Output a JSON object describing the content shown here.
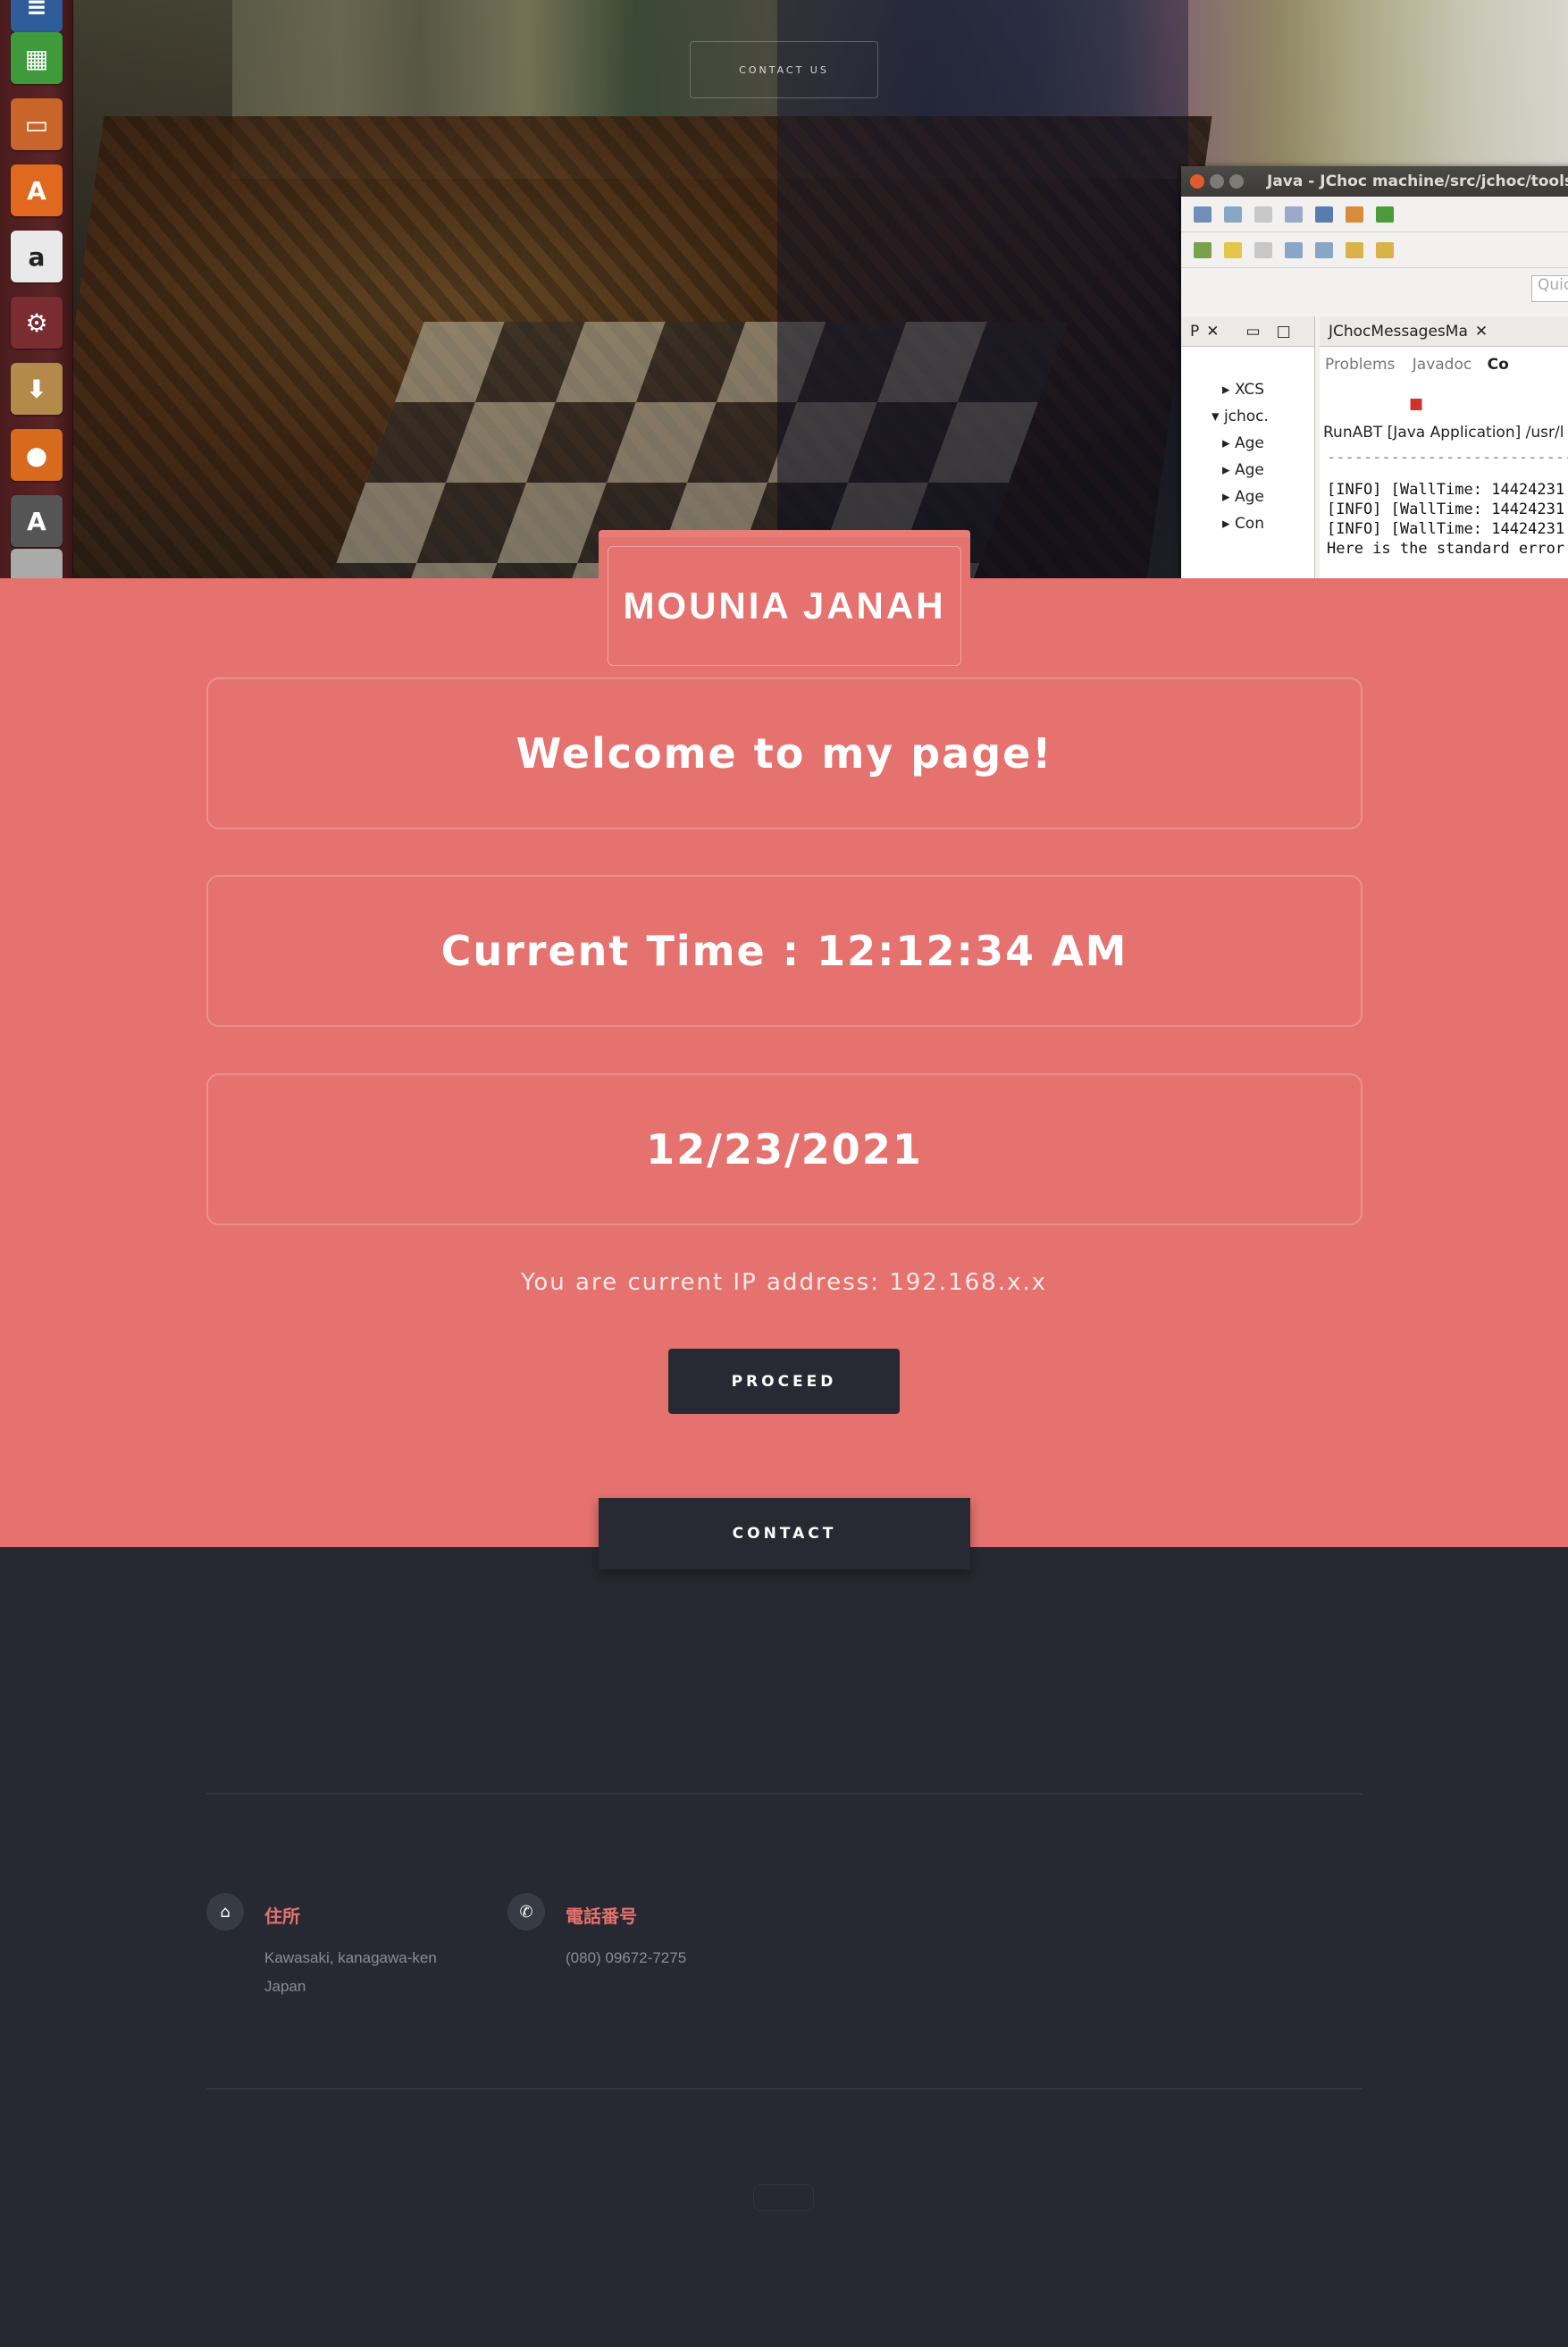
{
  "hero": {
    "contact_us_label": "CONTACT US",
    "launcher_icons": [
      "files-icon",
      "spreadsheet-icon",
      "presentation-icon",
      "software-center-icon",
      "amazon-icon",
      "settings-icon",
      "archive-icon",
      "firefox-icon",
      "software-updater-icon",
      "drive-icon"
    ],
    "eclipse": {
      "title": "Java - JChoc machine/src/jchoc/tools/",
      "quick_access": "Quic",
      "left_tab": "P",
      "editor_tab": "JChocMessagesMa",
      "problems_tab": "Problems",
      "javadoc_tab": "Javadoc",
      "console_tab": "Co",
      "tree": [
        "XCS",
        "jchoc.",
        "Age",
        "Age",
        "Age",
        "Con"
      ],
      "console_header": "RunABT [Java Application] /usr/l",
      "console_sep": "---------------------------",
      "console_lines": [
        "[INFO] [WallTime: 14424231",
        "[INFO] [WallTime: 14424231",
        "[INFO] [WallTime: 14424231",
        "Here is the standard error"
      ]
    }
  },
  "main": {
    "name": "MOUNIA JANAH",
    "welcome": "Welcome to my page!",
    "current_time": "Current Time : 12:12:34 AM",
    "date": "12/23/2021",
    "ip_text": "You are current IP address: 192.168.x.x",
    "proceed_label": "PROCEED",
    "contact_label": "CONTACT"
  },
  "footer": {
    "address": {
      "title": "住所",
      "line1": "Kawasaki, kanagawa-ken",
      "line2": "Japan",
      "icon": "home-icon"
    },
    "phone": {
      "title": "電話番号",
      "line1": "(080) 09672-7275",
      "icon": "phone-icon"
    }
  },
  "colors": {
    "accent": "#e5726e",
    "dark": "#262931",
    "button_dark": "#272a32"
  }
}
